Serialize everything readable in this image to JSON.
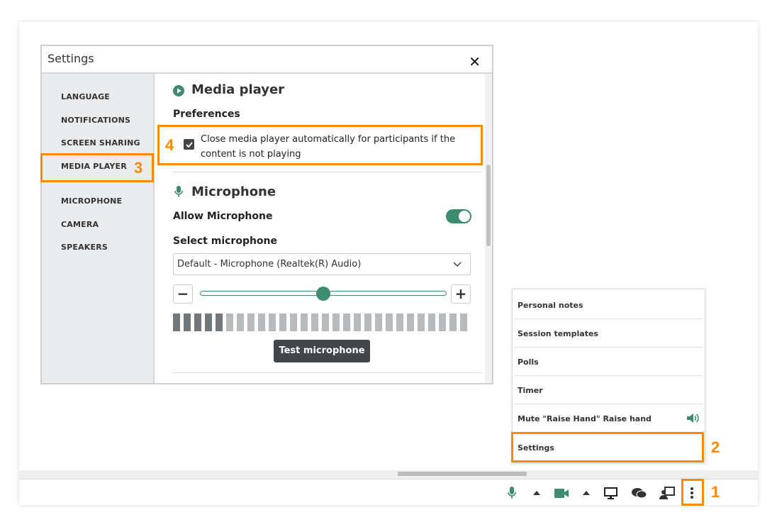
{
  "colors": {
    "accent": "#3d8c70",
    "callout": "#ff8a00",
    "sidebar_bg": "#ebecee"
  },
  "dialog": {
    "title": "Settings",
    "close_icon": "close-icon"
  },
  "sidebar": {
    "items": [
      {
        "label": "LANGUAGE"
      },
      {
        "label": "NOTIFICATIONS"
      },
      {
        "label": "SCREEN SHARING"
      },
      {
        "label": "MEDIA PLAYER",
        "selected": true
      },
      {
        "label": "MICROPHONE"
      },
      {
        "label": "CAMERA"
      },
      {
        "label": "SPEAKERS"
      }
    ]
  },
  "media_player": {
    "heading": "Media player",
    "icon": "play-circle-icon",
    "preferences_label": "Preferences",
    "checkbox_label": "Close media player automatically for participants if the content is not playing",
    "checked": true
  },
  "microphone": {
    "heading": "Microphone",
    "icon": "microphone-icon",
    "allow_label": "Allow Microphone",
    "allow_enabled": true,
    "select_label": "Select microphone",
    "selected_device": "Default - Microphone (Realtek(R) Audio)",
    "volume_percent": 50,
    "level_bars_total": 28,
    "level_bars_active": 5,
    "test_button": "Test microphone"
  },
  "menu": {
    "items": [
      {
        "label": "Personal notes"
      },
      {
        "label": "Session templates"
      },
      {
        "label": "Polls"
      },
      {
        "label": "Timer"
      },
      {
        "label": "Mute \"Raise Hand\" Raise hand",
        "icon": "speaker-icon"
      },
      {
        "label": "Settings"
      }
    ]
  },
  "callouts": {
    "one": "1",
    "two": "2",
    "three": "3",
    "four": "4"
  },
  "toolbar": {
    "icons": [
      "microphone-icon",
      "caret-up-icon",
      "camera-icon",
      "caret-up-icon",
      "screen-share-icon",
      "chat-icon",
      "presenter-icon",
      "more-vertical-icon"
    ]
  }
}
